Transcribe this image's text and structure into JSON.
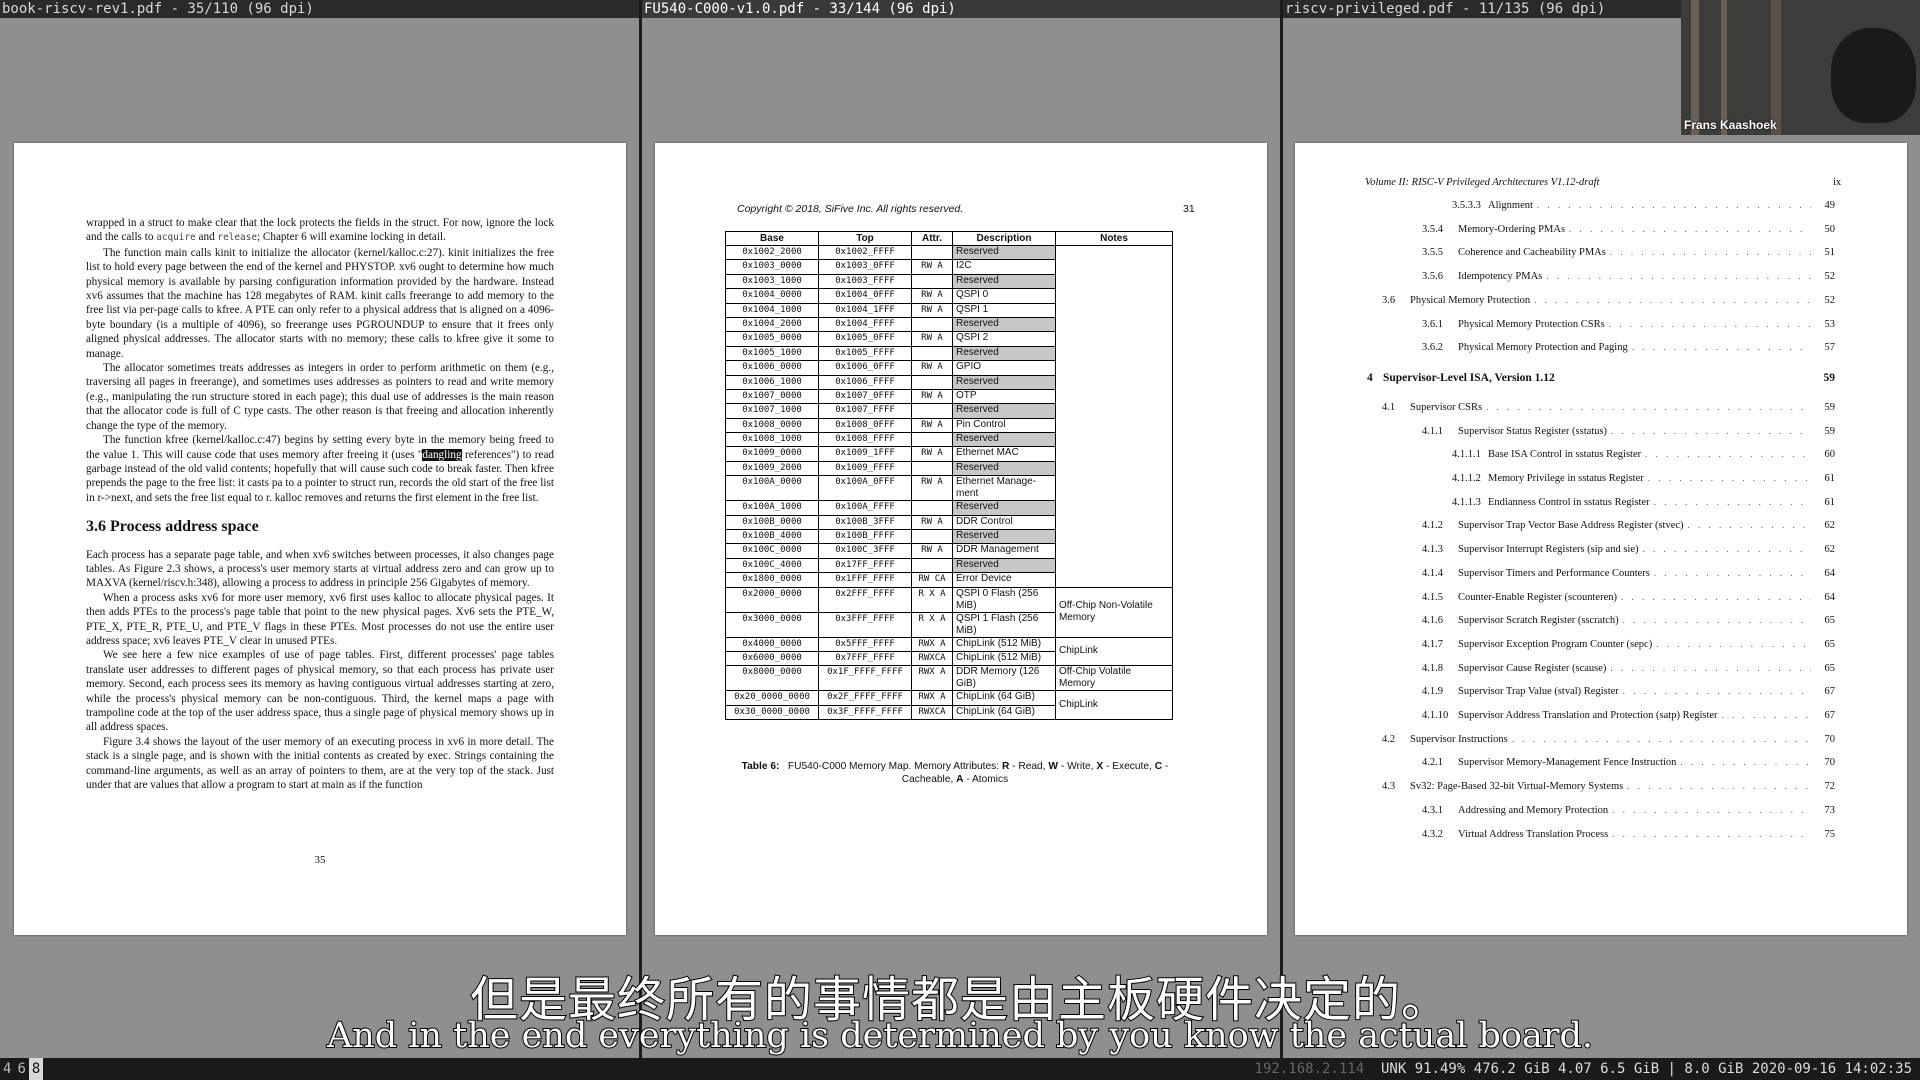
{
  "panes": [
    {
      "title": "book-riscv-rev1.pdf - 35/110 (96 dpi)"
    },
    {
      "title": "FU540-C000-v1.0.pdf - 33/144 (96 dpi)"
    },
    {
      "title": "riscv-privileged.pdf - 11/135 (96 dpi)"
    }
  ],
  "left_page": {
    "p1_a": "wrapped in a struct to make clear that the lock protects the fields in the struct. For now, ignore the lock and the calls to ",
    "p1_code1": "acquire",
    "p1_b": " and ",
    "p1_code2": "release",
    "p1_c": "; Chapter 6 will examine locking in detail.",
    "p2": "The function main calls kinit to initialize the allocator (kernel/kalloc.c:27). kinit initializes the free list to hold every page between the end of the kernel and PHYSTOP. xv6 ought to determine how much physical memory is available by parsing configuration information provided by the hardware. Instead xv6 assumes that the machine has 128 megabytes of RAM. kinit calls freerange to add memory to the free list via per-page calls to kfree. A PTE can only refer to a physical address that is aligned on a 4096-byte boundary (is a multiple of 4096), so freerange uses PGROUNDUP to ensure that it frees only aligned physical addresses. The allocator starts with no memory; these calls to kfree give it some to manage.",
    "p3": "The allocator sometimes treats addresses as integers in order to perform arithmetic on them (e.g., traversing all pages in freerange), and sometimes uses addresses as pointers to read and write memory (e.g., manipulating the run structure stored in each page); this dual use of addresses is the main reason that the allocator code is full of C type casts. The other reason is that freeing and allocation inherently change the type of the memory.",
    "p4_a": "The function kfree (kernel/kalloc.c:47) begins by setting every byte in the memory being freed to the value 1. This will cause code that uses memory after freeing it (uses \"",
    "p4_hl": "dangling",
    "p4_b": " references\") to read garbage instead of the old valid contents; hopefully that will cause such code to break faster. Then kfree prepends the page to the free list: it casts pa to a pointer to struct run, records the old start of the free list in r->next, and sets the free list equal to r. kalloc removes and returns the first element in the free list.",
    "heading": "3.6    Process address space",
    "p5": "Each process has a separate page table, and when xv6 switches between processes, it also changes page tables. As Figure 2.3 shows, a process's user memory starts at virtual address zero and can grow up to MAXVA (kernel/riscv.h:348), allowing a process to address in principle 256 Gigabytes of memory.",
    "p6": "When a process asks xv6 for more user memory, xv6 first uses kalloc to allocate physical pages. It then adds PTEs to the process's page table that point to the new physical pages. Xv6 sets the PTE_W, PTE_X, PTE_R, PTE_U, and PTE_V flags in these PTEs. Most processes do not use the entire user address space; xv6 leaves PTE_V clear in unused PTEs.",
    "p7": "We see here a few nice examples of use of page tables. First, different processes' page tables translate user addresses to different pages of physical memory, so that each process has private user memory. Second, each process sees its memory as having contiguous virtual addresses starting at zero, while the process's physical memory can be non-contiguous. Third, the kernel maps a page with trampoline code at the top of the user address space, thus a single page of physical memory shows up in all address spaces.",
    "p8": "Figure 3.4 shows the layout of the user memory of an executing process in xv6 in more detail. The stack is a single page, and is shown with the initial contents as created by exec. Strings containing the command-line arguments, as well as an array of pointers to them, are at the very top of the stack. Just under that are values that allow a program to start at main as if the function",
    "page_number": "35"
  },
  "middle_page": {
    "copyright": "Copyright © 2018, SiFive Inc. All rights reserved.",
    "page_number": "31",
    "headers": [
      "Base",
      "Top",
      "Attr.",
      "Description",
      "Notes"
    ],
    "rows": [
      {
        "base": "0x1002_2000",
        "top": "0x1002_FFFF",
        "attr": "",
        "desc": "Reserved",
        "res": true
      },
      {
        "base": "0x1003_0000",
        "top": "0x1003_0FFF",
        "attr": "RW  A",
        "desc": "I2C",
        "res": false
      },
      {
        "base": "0x1003_1000",
        "top": "0x1003_FFFF",
        "attr": "",
        "desc": "Reserved",
        "res": true
      },
      {
        "base": "0x1004_0000",
        "top": "0x1004_0FFF",
        "attr": "RW  A",
        "desc": "QSPI 0",
        "res": false
      },
      {
        "base": "0x1004_1000",
        "top": "0x1004_1FFF",
        "attr": "RW  A",
        "desc": "QSPI 1",
        "res": false
      },
      {
        "base": "0x1004_2000",
        "top": "0x1004_FFFF",
        "attr": "",
        "desc": "Reserved",
        "res": true
      },
      {
        "base": "0x1005_0000",
        "top": "0x1005_0FFF",
        "attr": "RW  A",
        "desc": "QSPI 2",
        "res": false
      },
      {
        "base": "0x1005_1000",
        "top": "0x1005_FFFF",
        "attr": "",
        "desc": "Reserved",
        "res": true
      },
      {
        "base": "0x1006_0000",
        "top": "0x1006_0FFF",
        "attr": "RW  A",
        "desc": "GPIO",
        "res": false
      },
      {
        "base": "0x1006_1000",
        "top": "0x1006_FFFF",
        "attr": "",
        "desc": "Reserved",
        "res": true
      },
      {
        "base": "0x1007_0000",
        "top": "0x1007_0FFF",
        "attr": "RW  A",
        "desc": "OTP",
        "res": false
      },
      {
        "base": "0x1007_1000",
        "top": "0x1007_FFFF",
        "attr": "",
        "desc": "Reserved",
        "res": true
      },
      {
        "base": "0x1008_0000",
        "top": "0x1008_0FFF",
        "attr": "RW  A",
        "desc": "Pin Control",
        "res": false
      },
      {
        "base": "0x1008_1000",
        "top": "0x1008_FFFF",
        "attr": "",
        "desc": "Reserved",
        "res": true
      },
      {
        "base": "0x1009_0000",
        "top": "0x1009_1FFF",
        "attr": "RW  A",
        "desc": "Ethernet MAC",
        "res": false
      },
      {
        "base": "0x1009_2000",
        "top": "0x1009_FFFF",
        "attr": "",
        "desc": "Reserved",
        "res": true
      },
      {
        "base": "0x100A_0000",
        "top": "0x100A_0FFF",
        "attr": "RW  A",
        "desc": "Ethernet Manage- ment",
        "res": false
      },
      {
        "base": "0x100A_1000",
        "top": "0x100A_FFFF",
        "attr": "",
        "desc": "Reserved",
        "res": true
      },
      {
        "base": "0x100B_0000",
        "top": "0x100B_3FFF",
        "attr": "RW  A",
        "desc": "DDR Control",
        "res": false
      },
      {
        "base": "0x100B_4000",
        "top": "0x100B_FFFF",
        "attr": "",
        "desc": "Reserved",
        "res": true
      },
      {
        "base": "0x100C_0000",
        "top": "0x100C_3FFF",
        "attr": "RW  A",
        "desc": "DDR Management",
        "res": false
      },
      {
        "base": "0x100C_4000",
        "top": "0x17FF_FFFF",
        "attr": "",
        "desc": "Reserved",
        "res": true
      },
      {
        "base": "0x1800_0000",
        "top": "0x1FFF_FFFF",
        "attr": "RW CA",
        "desc": "Error Device",
        "res": false
      },
      {
        "base": "0x2000_0000",
        "top": "0x2FFF_FFFF",
        "attr": "R X A",
        "desc": "QSPI 0 Flash (256 MiB)",
        "res": false
      },
      {
        "base": "0x3000_0000",
        "top": "0x3FFF_FFFF",
        "attr": "R X A",
        "desc": "QSPI 1 Flash (256 MiB)",
        "res": false
      },
      {
        "base": "0x4000_0000",
        "top": "0x5FFF_FFFF",
        "attr": "RWX A",
        "desc": "ChipLink (512 MiB)",
        "res": false
      },
      {
        "base": "0x6000_0000",
        "top": "0x7FFF_FFFF",
        "attr": "RWXCA",
        "desc": "ChipLink (512 MiB)",
        "res": false
      },
      {
        "base": "0x8000_0000",
        "top": "0x1F_FFFF_FFFF",
        "attr": "RWX A",
        "desc": "DDR Memory (126 GiB)",
        "res": false
      },
      {
        "base": "0x20_0000_0000",
        "top": "0x2F_FFFF_FFFF",
        "attr": "RWX A",
        "desc": "ChipLink (64 GiB)",
        "res": false
      },
      {
        "base": "0x30_0000_0000",
        "top": "0x3F_FFFF_FFFF",
        "attr": "RWXCA",
        "desc": "ChipLink (64 GiB)",
        "res": false
      }
    ],
    "notes": {
      "flash": "Off-Chip Non-Volatile Memory",
      "chiplink1": "ChipLink",
      "ddr": "Off-Chip Volatile Memory",
      "chiplink2": "ChipLink"
    },
    "caption_label": "Table 6:",
    "caption_text": "FU540-C000 Memory Map. Memory Attributes:",
    "caption_r": "R",
    "caption_r_t": "- Read,",
    "caption_w": "W",
    "caption_w_t": "- Write,",
    "caption_x": "X",
    "caption_x_t": "- Execute,",
    "caption_c": "C",
    "caption_c_t": "- Cacheable,",
    "caption_a": "A",
    "caption_a_t": "- Atomics"
  },
  "right_page": {
    "header": "Volume II: RISC-V Privileged Architectures V1.12-draft",
    "page_number": "ix",
    "toc": [
      {
        "num": "3.5.3.3",
        "title": "Alignment",
        "page": "49"
      },
      {
        "num": "3.5.4",
        "title": "Memory-Ordering PMAs",
        "page": "50"
      },
      {
        "num": "3.5.5",
        "title": "Coherence and Cacheability PMAs",
        "page": "51"
      },
      {
        "num": "3.5.6",
        "title": "Idempotency PMAs",
        "page": "52"
      },
      {
        "num": "3.6",
        "title": "Physical Memory Protection",
        "page": "52"
      },
      {
        "num": "3.6.1",
        "title": "Physical Memory Protection CSRs",
        "page": "53"
      },
      {
        "num": "3.6.2",
        "title": "Physical Memory Protection and Paging",
        "page": "57"
      },
      {
        "num": "4",
        "title": "Supervisor-Level ISA, Version 1.12",
        "page": "59"
      },
      {
        "num": "4.1",
        "title": "Supervisor CSRs",
        "page": "59"
      },
      {
        "num": "4.1.1",
        "title": "Supervisor Status Register (sstatus)",
        "page": "59"
      },
      {
        "num": "4.1.1.1",
        "title": "Base ISA Control in sstatus Register",
        "page": "60"
      },
      {
        "num": "4.1.1.2",
        "title": "Memory Privilege in sstatus Register",
        "page": "61"
      },
      {
        "num": "4.1.1.3",
        "title": "Endianness Control in sstatus Register",
        "page": "61"
      },
      {
        "num": "4.1.2",
        "title": "Supervisor Trap Vector Base Address Register (stvec)",
        "page": "62"
      },
      {
        "num": "4.1.3",
        "title": "Supervisor Interrupt Registers (sip and sie)",
        "page": "62"
      },
      {
        "num": "4.1.4",
        "title": "Supervisor Timers and Performance Counters",
        "page": "64"
      },
      {
        "num": "4.1.5",
        "title": "Counter-Enable Register (scounteren)",
        "page": "64"
      },
      {
        "num": "4.1.6",
        "title": "Supervisor Scratch Register (sscratch)",
        "page": "65"
      },
      {
        "num": "4.1.7",
        "title": "Supervisor Exception Program Counter (sepc)",
        "page": "65"
      },
      {
        "num": "4.1.8",
        "title": "Supervisor Cause Register (scause)",
        "page": "65"
      },
      {
        "num": "4.1.9",
        "title": "Supervisor Trap Value (stval) Register",
        "page": "67"
      },
      {
        "num": "4.1.10",
        "title": "Supervisor Address Translation and Protection (satp) Register",
        "page": "67"
      },
      {
        "num": "4.2",
        "title": "Supervisor Instructions",
        "page": "70"
      },
      {
        "num": "4.2.1",
        "title": "Supervisor Memory-Management Fence Instruction",
        "page": "70"
      },
      {
        "num": "4.3",
        "title": "Sv32: Page-Based 32-bit Virtual-Memory Systems",
        "page": "72"
      },
      {
        "num": "4.3.1",
        "title": "Addressing and Memory Protection",
        "page": "73"
      },
      {
        "num": "4.3.2",
        "title": "Virtual Address Translation Process",
        "page": "75"
      }
    ]
  },
  "webcam": {
    "name": "Frans Kaashoek"
  },
  "subtitles": {
    "chinese": "但是最终所有的事情都是由主板硬件决定的。",
    "english": "And in the end everything is determined by you know the actual board."
  },
  "statusbar": {
    "workspaces": [
      "4",
      "6",
      "8"
    ],
    "active_workspace": "8",
    "ip": "192.168.2.114",
    "status": "UNK 91.49% 476.2 GiB 4.07 6.5 GiB | 8.0 GiB 2020-09-16 14:02:35"
  }
}
